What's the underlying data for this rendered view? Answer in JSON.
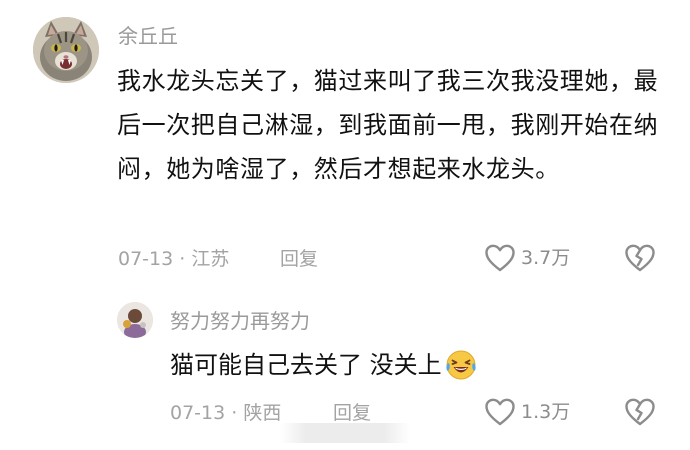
{
  "comment": {
    "author": "余丘丘",
    "text": "我水龙头忘关了，猫过来叫了我三次我没理她，最后一次把自己淋湿，到我面前一甩，我刚开始在纳闷，她为啥湿了，然后才想起来水龙头。",
    "meta": "07-13 · 江苏",
    "reply_label": "回复",
    "likes": "3.7万",
    "avatar_icon": "cat-avatar-icon"
  },
  "reply": {
    "author": "努力努力再努力",
    "text": "猫可能自己去关了 没关上",
    "meta": "07-13 · 陕西",
    "reply_label": "回复",
    "likes": "1.3万",
    "emoji_icon": "laughing-crying-emoji-icon"
  },
  "colors": {
    "text_primary": "#111111",
    "text_secondary": "#9a9a9a",
    "icon_gray": "#8c8c8c",
    "background": "#ffffff"
  }
}
